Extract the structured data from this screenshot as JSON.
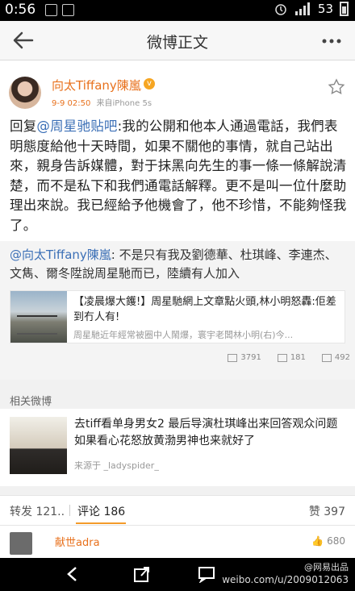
{
  "status_bar": {
    "time": "0:56",
    "signal": "4G",
    "battery": "53"
  },
  "nav": {
    "title": "微博正文"
  },
  "post": {
    "author": "向太Tiffany陳嵐",
    "time": "9-9 02:50",
    "source": "来自iPhone 5s",
    "text_prefix": "回复",
    "mention": "@周星驰贴吧",
    "text": ":我的公開和他本人通過電話，我們表明態度給他十天時間，如果不關他的事情，就自己站出來，親身告訴媒體，對于抹黑向先生的事一條一條解說清楚，而不是私下和我們通電話解釋。更不是叫一位什麼助理出來說。我已經給予他機會了，他不珍惜，不能夠怪我了。"
  },
  "repost": {
    "mention": "@向太Tiffany陳嵐",
    "text": ": 不是只有我及劉德華、杜琪峰、李連杰、文雋、爾冬陞說周星馳而已，陸續有人加入",
    "article_title": "【凌晨爆大鑊!】周星馳網上文章點火頭,林小明怒轟:佢差到冇人有!",
    "article_desc": "周星馳近年經常被圈中人鬧爆，寰宇老闆林小明(右)今..."
  },
  "actions": {
    "reposts": "3791",
    "comments": "181",
    "likes": "492"
  },
  "related": {
    "heading": "相关微博",
    "title": "去tiff看单身男女2 最后导演杜琪峰出来回答观众问题 如果看心花怒放黄渤男神也来就好了",
    "source": "来源于 _ladyspider_"
  },
  "tabs": {
    "forward": "转发 121..",
    "comment": "评论 186",
    "like": "赞 397"
  },
  "comment": {
    "name": "献世adra",
    "likes": "680"
  },
  "watermark": {
    "line1": "@网易出品",
    "line2": "weibo.com/u/2009012063"
  }
}
